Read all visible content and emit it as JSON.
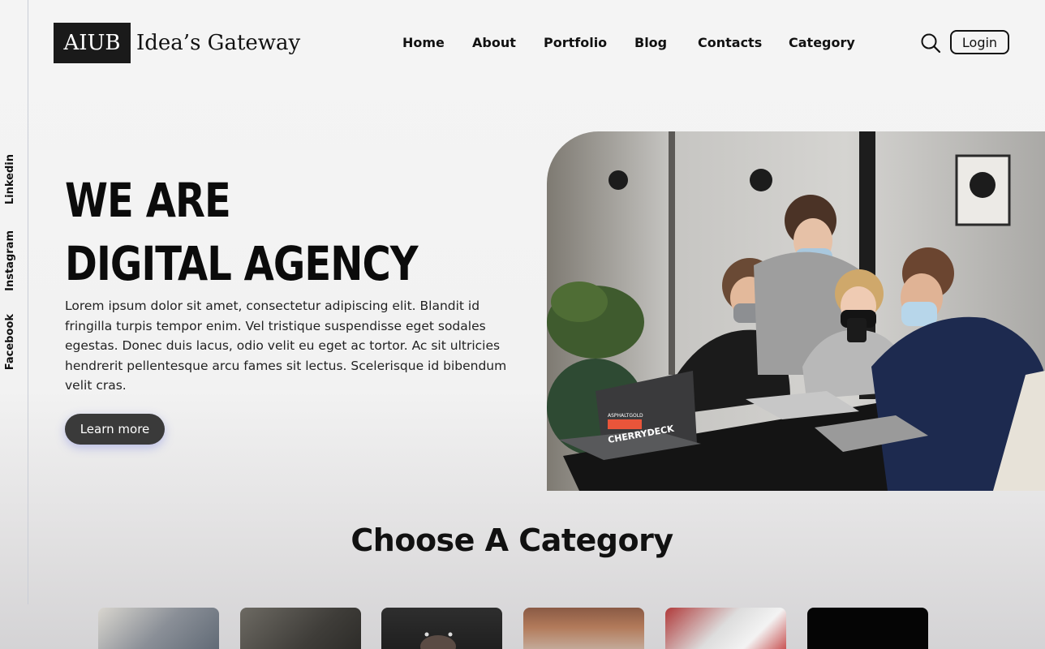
{
  "social": {
    "linkedin": "Linkedin",
    "instagram": "Instagram",
    "facebook": "Facebook"
  },
  "logo": {
    "box_text": "AIUB",
    "text": "Idea’s Gateway"
  },
  "nav": {
    "items": [
      {
        "label": "Home"
      },
      {
        "label": "About"
      },
      {
        "label": "Portfolio"
      },
      {
        "label": "Blog"
      },
      {
        "label": "Contacts"
      },
      {
        "label": "Category"
      }
    ]
  },
  "header": {
    "search_icon": "search-icon",
    "login_label": "Login"
  },
  "hero": {
    "title_line1": "WE ARE",
    "title_line2": "DIGITAL AGENCY",
    "text": "Lorem ipsum dolor sit amet, consectetur adipiscing elit. Blandit id fringilla turpis tempor enim. Vel tristique suspendisse eget sodales egestas. Donec duis lacus, odio velit eu eget ac tortor. Ac sit ultricies hendrerit pellentesque arcu fames sit lectus. Scelerisque id bibendum velit cras.",
    "button_label": "Learn more",
    "laptop_sticker_1": "ASPHALTGOLD",
    "laptop_sticker_2": "CHERRYDECK"
  },
  "categories": {
    "title": "Choose A Category"
  },
  "colors": {
    "button_bg": "#3a3a3a",
    "button_glow": "#5a64dc",
    "logo_bg": "#1a1a1a",
    "text": "#111111"
  }
}
